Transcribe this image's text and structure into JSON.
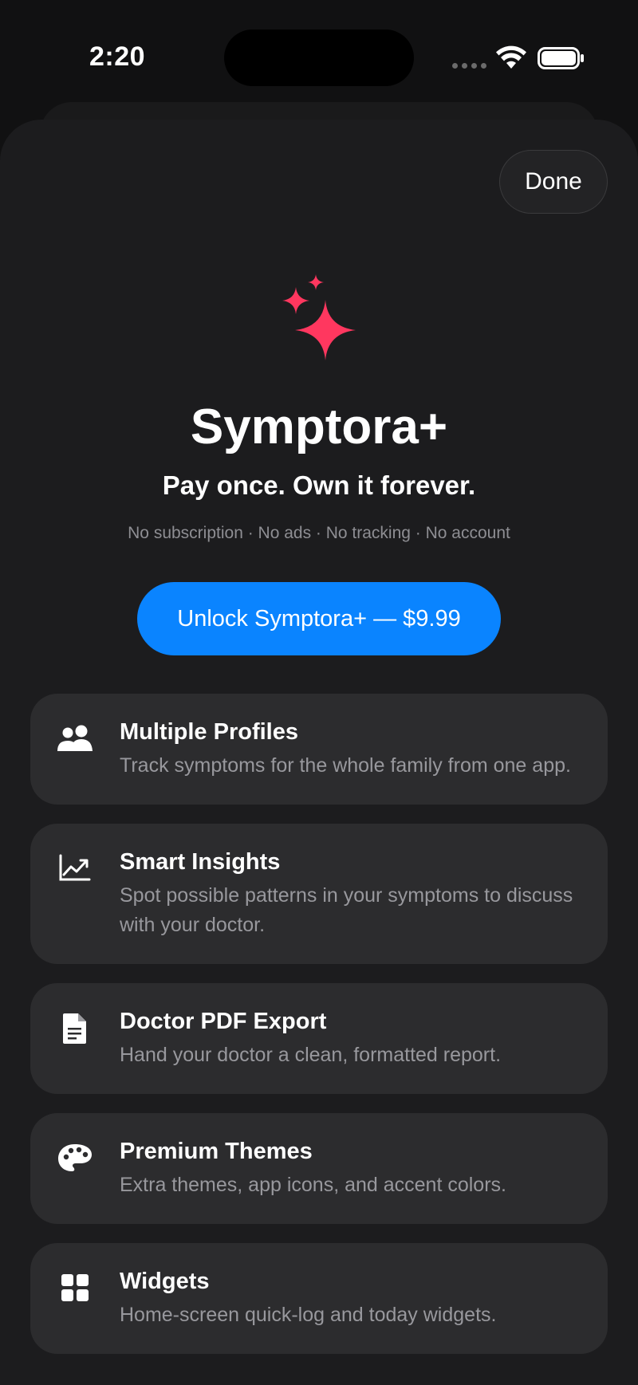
{
  "status_bar": {
    "time": "2:20"
  },
  "sheet": {
    "done_label": "Done",
    "icon": "sparkles-icon",
    "accent_color": "#ff375f",
    "title": "Symptora+",
    "subtitle": "Pay once. Own it forever.",
    "tagline": "No subscription · No ads · No tracking · No account",
    "unlock_label": "Unlock Symptora+ — $9.99",
    "button_color": "#0a84ff"
  },
  "features": [
    {
      "icon": "people-icon",
      "title": "Multiple Profiles",
      "description": "Track symptoms for the whole family from one app."
    },
    {
      "icon": "chart-trend-icon",
      "title": "Smart Insights",
      "description": "Spot possible patterns in your symptoms to discuss with your doctor."
    },
    {
      "icon": "document-icon",
      "title": "Doctor PDF Export",
      "description": "Hand your doctor a clean, formatted report."
    },
    {
      "icon": "palette-icon",
      "title": "Premium Themes",
      "description": "Extra themes, app icons, and accent colors."
    },
    {
      "icon": "widgets-grid-icon",
      "title": "Widgets",
      "description": "Home-screen quick-log and today widgets."
    }
  ]
}
